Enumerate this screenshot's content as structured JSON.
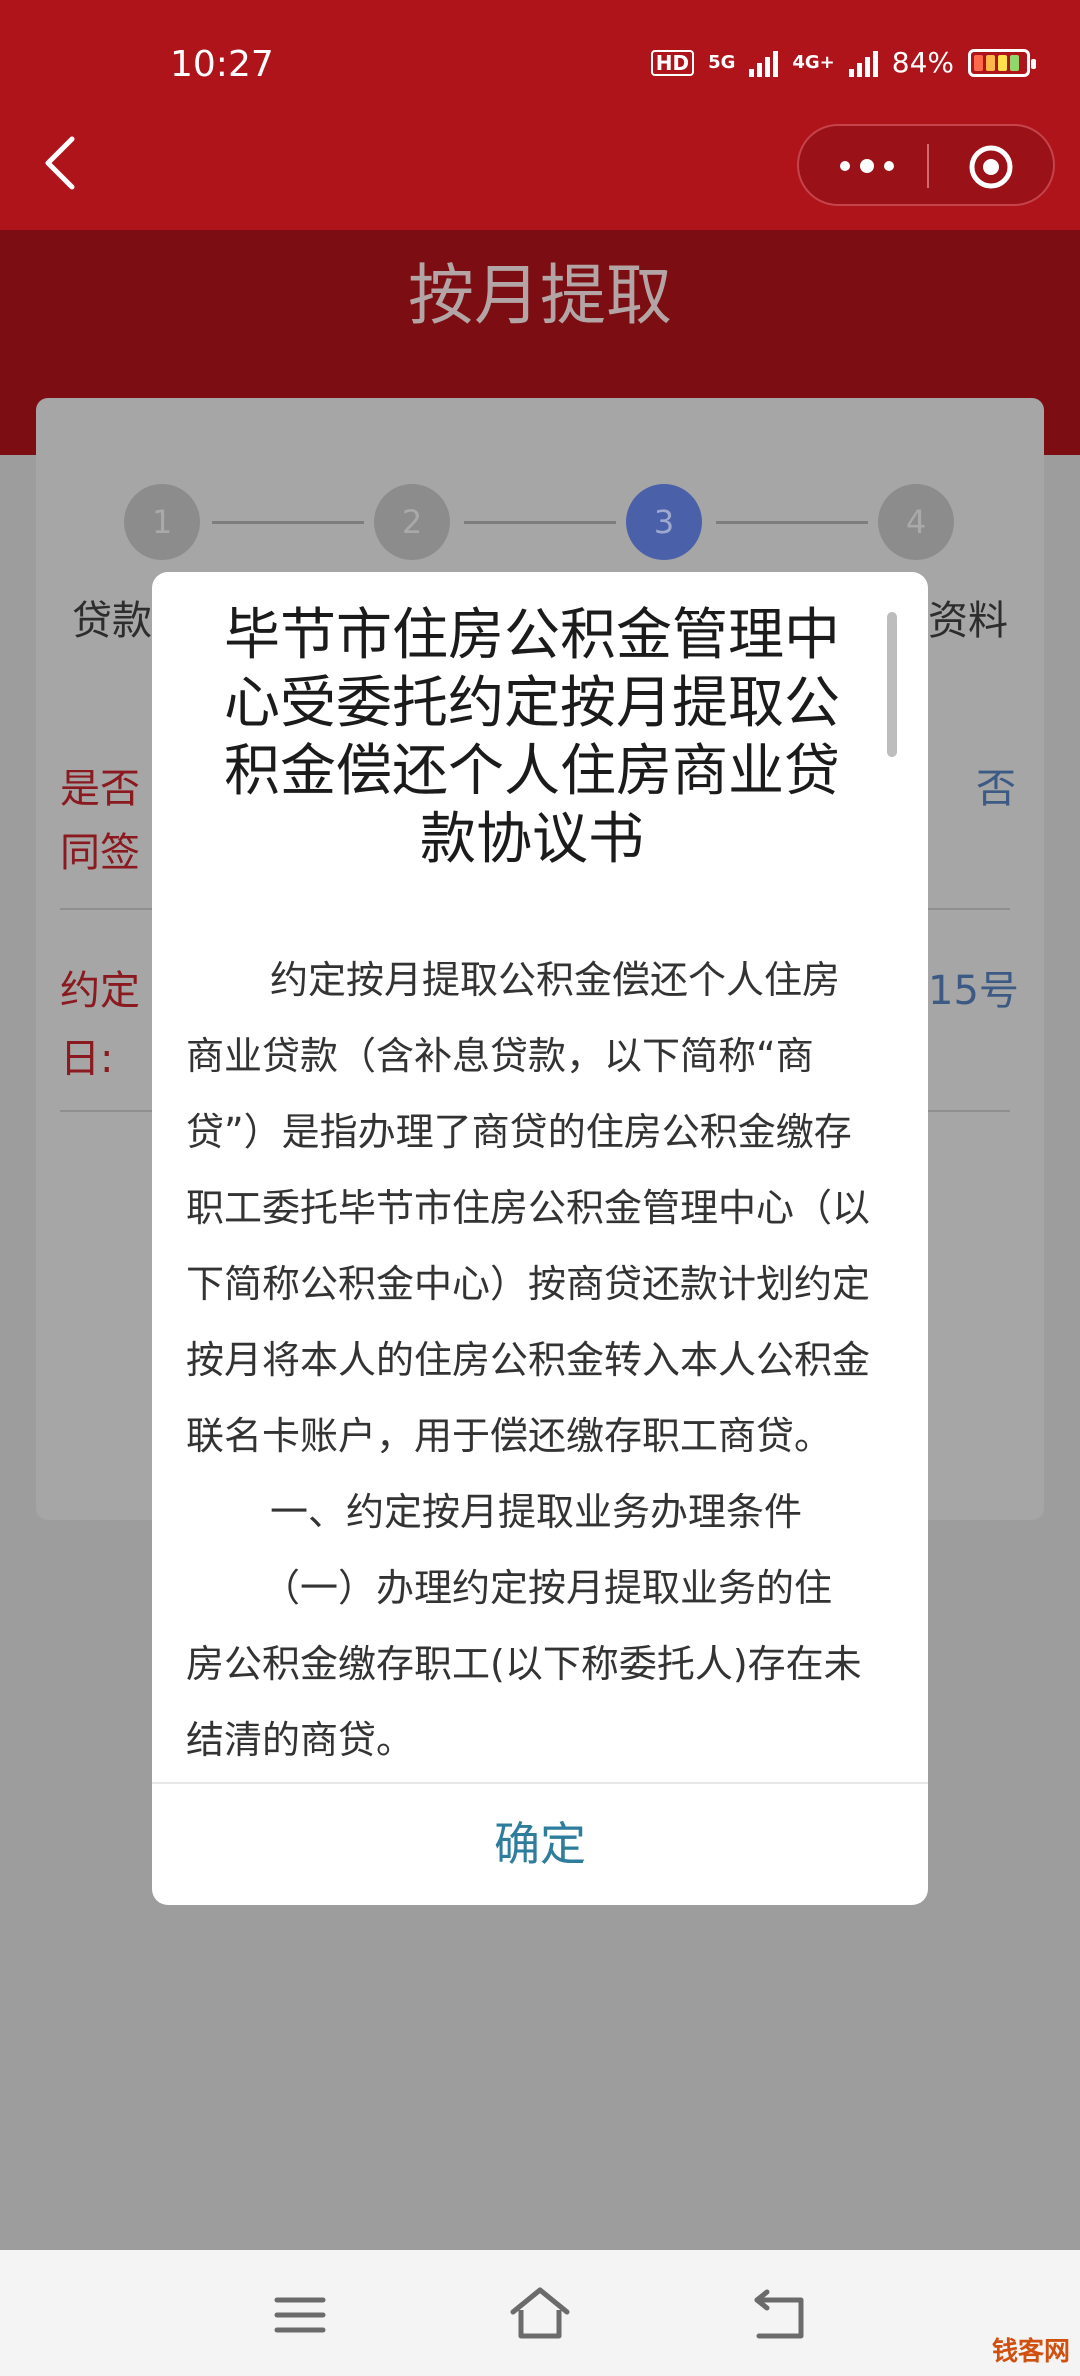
{
  "status_bar": {
    "time": "10:27",
    "network_1": "5G",
    "network_2": "4G+",
    "battery": "84%"
  },
  "header": {
    "title": "按月提取"
  },
  "steps": [
    {
      "number": "1",
      "active": false
    },
    {
      "number": "2",
      "active": false
    },
    {
      "number": "3",
      "active": true
    },
    {
      "number": "4",
      "active": false
    }
  ],
  "background": {
    "step1_label": "贷款",
    "step4_label": "资料",
    "row1_label_line1": "是否",
    "row1_label_line2": "同签",
    "row1_value": "否",
    "row2_label_line1": "约定",
    "row2_label_line2": "日:",
    "row2_value": "15号"
  },
  "modal": {
    "title_lines": [
      "毕节市住房公积金管理中",
      "心受委托约定按月提取公",
      "积金偿还个人住房商业贷",
      "款协议书"
    ],
    "body_lines": [
      "约定按月提取公积金偿还个人住房",
      "商业贷款（含补息贷款，以下简称“商",
      "贷”）是指办理了商贷的住房公积金缴存",
      "职工委托毕节市住房公积金管理中心（以",
      "下简称公积金中心）按商贷还款计划约定",
      "按月将本人的住房公积金转入本人公积金",
      "联名卡账户，用于偿还缴存职工商贷。",
      "一、约定按月提取业务办理条件",
      "（一）办理约定按月提取业务的住",
      "房公积金缴存职工(以下称委托人)存在未",
      "结清的商贷。"
    ],
    "confirm_label": "确定"
  },
  "watermark": "钱客网"
}
